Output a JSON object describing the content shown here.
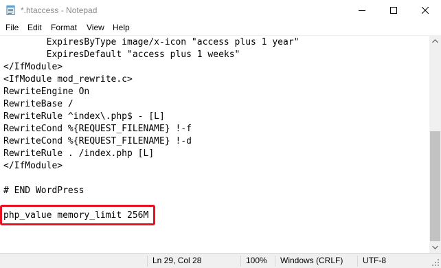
{
  "window": {
    "title": "*.htaccess - Notepad",
    "icon": "notepad-icon"
  },
  "menu": [
    "File",
    "Edit",
    "Format",
    "View",
    "Help"
  ],
  "editor": {
    "lines": [
      "        ExpiresByType image/x-icon \"access plus 1 year\"",
      "        ExpiresDefault \"access plus 1 weeks\"",
      "</IfModule>",
      "<IfModule mod_rewrite.c>",
      "RewriteEngine On",
      "RewriteBase /",
      "RewriteRule ^index\\.php$ - [L]",
      "RewriteCond %{REQUEST_FILENAME} !-f",
      "RewriteCond %{REQUEST_FILENAME} !-d",
      "RewriteRule . /index.php [L]",
      "</IfModule>",
      "",
      "# END WordPress",
      "",
      "php_value memory_limit 256M"
    ],
    "highlight_color": "#e81123"
  },
  "status": {
    "position": "Ln 29, Col 28",
    "zoom": "100%",
    "line_endings": "Windows (CRLF)",
    "encoding": "UTF-8"
  }
}
